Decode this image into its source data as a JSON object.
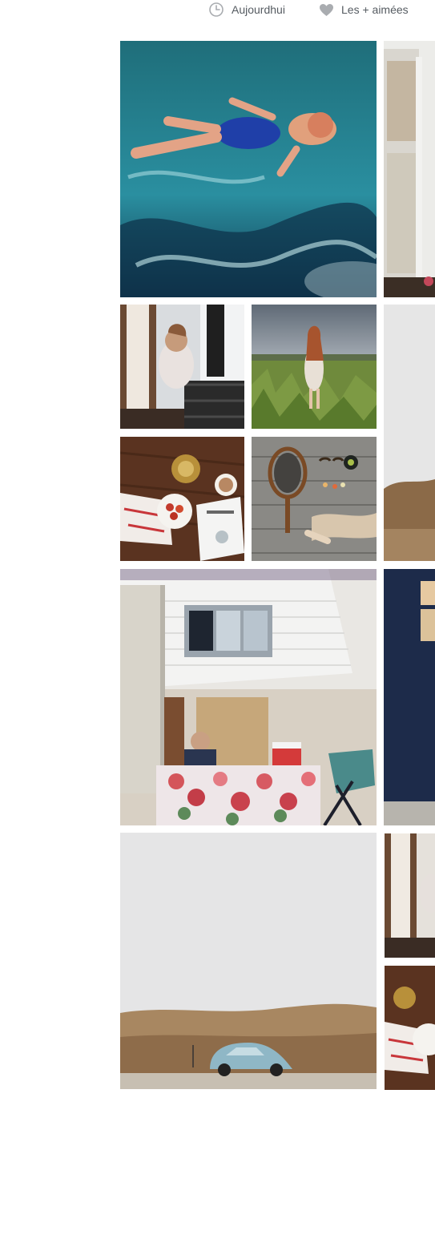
{
  "header": {
    "tabs": [
      {
        "label": "Aujourdhui",
        "icon": "clock-icon"
      },
      {
        "label": "Les + aimées",
        "icon": "heart-icon"
      }
    ]
  },
  "colors": {
    "tab_text": "#555b61",
    "tab_icon": "#a9acb0",
    "background": "#ffffff"
  },
  "gallery": {
    "tiles": [
      {
        "subject": "girl swimming in pool"
      },
      {
        "subject": "camper trailer (cropped)"
      },
      {
        "subject": "girl on balcony"
      },
      {
        "subject": "woman in field"
      },
      {
        "subject": "breakfast table with magazine"
      },
      {
        "subject": "fishing net on dock"
      },
      {
        "subject": "pale landscape (cropped)"
      },
      {
        "subject": "camper with man and floral table"
      },
      {
        "subject": "blue wall (cropped)"
      },
      {
        "subject": "car in desert landscape"
      },
      {
        "subject": "girl on balcony (cropped)"
      },
      {
        "subject": "breakfast table (cropped)"
      }
    ]
  }
}
